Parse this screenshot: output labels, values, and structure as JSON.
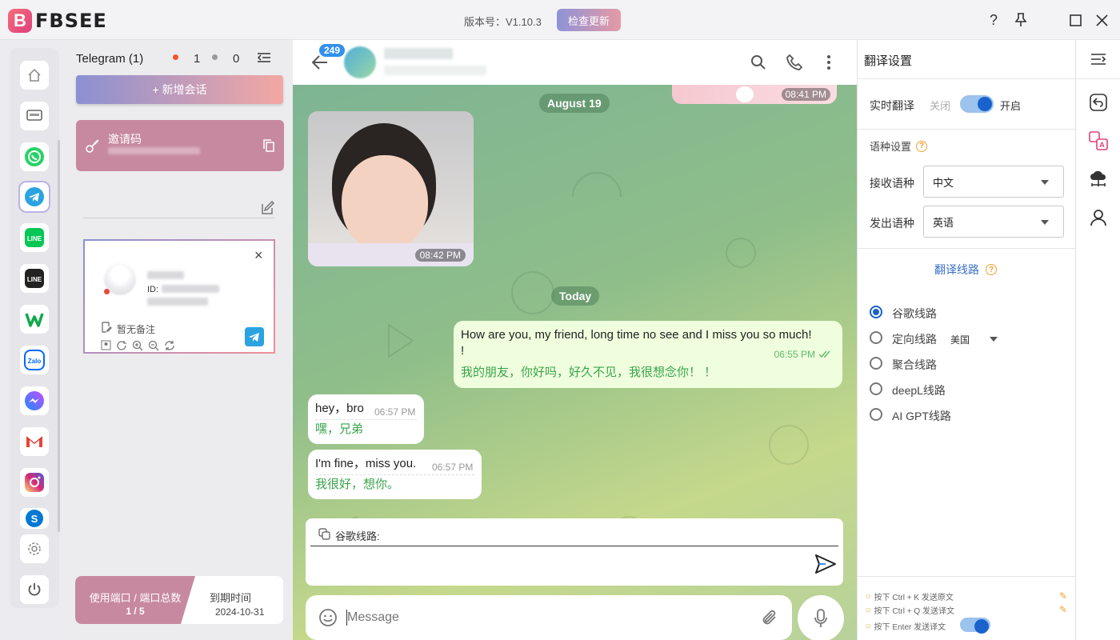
{
  "app": {
    "name": "FBSEE",
    "logo_letter": "B",
    "version": "版本号：V1.10.3",
    "update_button": "检查更新",
    "window_controls": [
      "help-icon",
      "pin-icon",
      "maximize-icon",
      "close-icon"
    ]
  },
  "rail": {
    "items": [
      {
        "name": "home",
        "icon": "home-icon"
      },
      {
        "name": "chat",
        "icon": "message-icon"
      },
      {
        "name": "whatsapp",
        "icon": "whatsapp-icon"
      },
      {
        "name": "telegram",
        "icon": "telegram-icon"
      },
      {
        "name": "line-green",
        "icon": "line-icon"
      },
      {
        "name": "line-black",
        "icon": "line-icon"
      },
      {
        "name": "wechat-w",
        "icon": "w-icon"
      },
      {
        "name": "zalo",
        "icon": "zalo-icon"
      },
      {
        "name": "messenger",
        "icon": "messenger-icon"
      },
      {
        "name": "gmail",
        "icon": "gmail-icon"
      },
      {
        "name": "instagram",
        "icon": "instagram-icon"
      },
      {
        "name": "skype",
        "icon": "skype-icon"
      }
    ],
    "active": "telegram",
    "colors": {
      "whatsapp": "#25d366",
      "telegram": "#2aa3e0",
      "line": "#06c755",
      "zalo": "#0068ff",
      "messenger": "#8a5cf6",
      "instagram": "#e1306c",
      "skype": "#0078d4"
    }
  },
  "sessions": {
    "header": "Telegram (1)",
    "online_count": "1",
    "offline_count": "0",
    "add_button": "+ 新增会话",
    "invite_label": "邀请码",
    "card": {
      "id_label": "ID:",
      "note": "暂无备注"
    },
    "footer": {
      "ports_label": "使用端口 / 端口总数",
      "ports_value": "1 / 5",
      "expiry_label": "到期时间",
      "expiry_value": "2024-10-31"
    }
  },
  "chat": {
    "unread_badge": "249",
    "date_1": "August 19",
    "top_photo_time": "08:41 PM",
    "photo_time": "08:42 PM",
    "date_2": "Today",
    "messages": [
      {
        "dir": "out",
        "text": "How are you, my friend, long time no see and I miss you so much!",
        "text2": "!",
        "time": "06:55 PM",
        "translation": "我的朋友，你好吗，好久不见，我很想念你！ ！"
      },
      {
        "dir": "in",
        "text": "hey，bro",
        "time": "06:57 PM",
        "translation": "嘿，兄弟"
      },
      {
        "dir": "in",
        "text": "I'm fine，miss you.",
        "time": "06:57 PM",
        "translation": "我很好，想你。"
      }
    ],
    "translate_route_label": "谷歌线路:",
    "message_placeholder": "Message"
  },
  "settings": {
    "title": "翻译设置",
    "realtime_label": "实时翻译",
    "off_label": "关闭",
    "on_label": "开启",
    "realtime_on": true,
    "lang_section": "语种设置",
    "receive_label": "接收语种",
    "receive_value": "中文",
    "send_label": "发出语种",
    "send_value": "英语",
    "route_title": "翻译线路",
    "routes": [
      "谷歌线路",
      "定向线路",
      "聚合线路",
      "deepL线路",
      "AI GPT线路"
    ],
    "selected_route": 0,
    "directed_region": "美国",
    "hints": [
      "按下 Ctrl + K 发送原文",
      "按下 Ctrl + Q 发送译文",
      "按下 Enter 发送译文"
    ],
    "enter_sends_translation": true
  }
}
